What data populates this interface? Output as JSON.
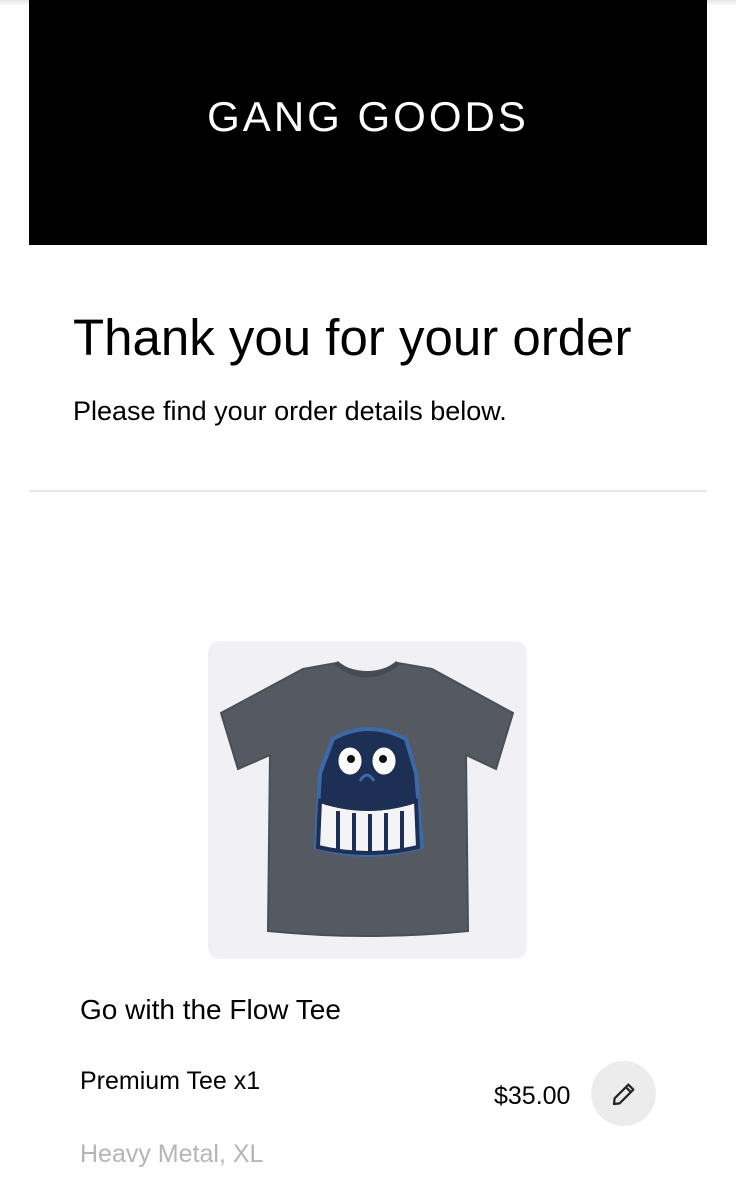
{
  "header": {
    "brand_name": "GANG GOODS"
  },
  "confirmation": {
    "title": "Thank you for your order",
    "subtitle": "Please find your order details below."
  },
  "order_item": {
    "image_icon": "tshirt-product-image",
    "name": "Go with the Flow Tee",
    "variant": "Premium Tee x1",
    "price": "$35.00",
    "options": "Heavy Metal, XL",
    "edit_icon": "pencil-icon"
  },
  "colors": {
    "banner_background": "#000000",
    "banner_text": "#ffffff",
    "muted_text": "#b5b5b5",
    "tee_color": "#555a62",
    "edit_button_bg": "#ececec"
  }
}
